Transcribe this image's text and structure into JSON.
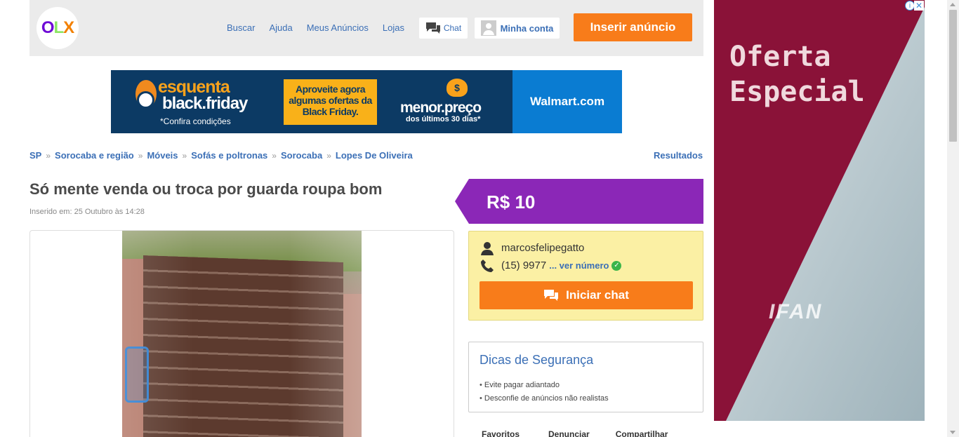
{
  "header": {
    "logo_o": "O",
    "logo_l": "L",
    "logo_x": "X",
    "nav": [
      "Buscar",
      "Ajuda",
      "Meus Anúncios",
      "Lojas"
    ],
    "chat_label": "Chat",
    "account_label": "Minha conta",
    "insert_label": "Inserir anúncio"
  },
  "banner": {
    "esquenta": "esquenta",
    "black_friday": "black.friday",
    "confira": "*Confira condições",
    "offer": "Aproveite agora algumas ofertas da Black Friday.",
    "menor_preco": "menor.preço",
    "ultimos": "dos últimos 30 dias*",
    "coin": "$",
    "brand": "Walmart.com"
  },
  "breadcrumb": {
    "items": [
      "SP",
      "Sorocaba e região",
      "Móveis",
      "Sofás e poltronas",
      "Sorocaba",
      "Lopes De Oliveira"
    ],
    "separator": "»",
    "results": "Resultados"
  },
  "listing": {
    "title": "Só mente venda ou troca por guarda roupa bom",
    "inserted": "Inserido em: 25 Outubro às 14:28",
    "price": "R$ 10"
  },
  "seller": {
    "name": "marcosfelipegatto",
    "phone": "(15) 9977",
    "phone_link": "... ver número",
    "verified": "✓",
    "chat_label": "Iniciar chat"
  },
  "tips": {
    "title": "Dicas de Segurança",
    "items": [
      "Evite pagar adiantado",
      "Desconfie de anúncios não realistas"
    ]
  },
  "actions": {
    "favorites": "Favoritos",
    "report": "Denunciar",
    "share": "Compartilhar"
  },
  "ad": {
    "line1": "Oferta",
    "line2": "Especial",
    "brand": "IFAN",
    "info": "i",
    "close": "✕",
    "colors": {
      "crimson": "#8a1238",
      "bg": "#e8eef0"
    }
  },
  "colors": {
    "accent_orange": "#f87c1a",
    "price_purple": "#8b27b7",
    "link_blue": "#3b6fb6",
    "seller_yellow": "#fbf0a4"
  }
}
